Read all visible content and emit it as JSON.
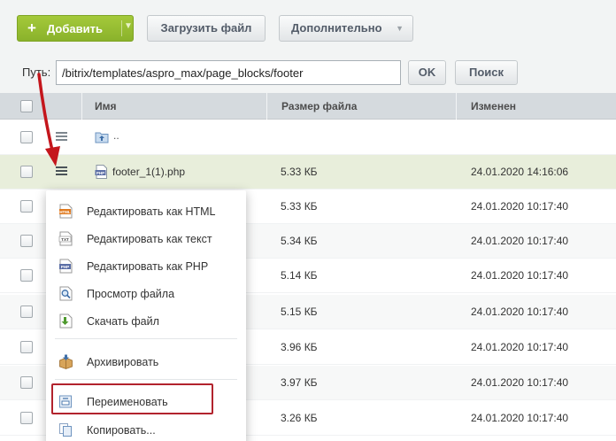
{
  "toolbar": {
    "add_label": "Добавить",
    "upload_label": "Загрузить файл",
    "more_label": "Дополнительно"
  },
  "path": {
    "label": "Путь:",
    "value": "/bitrix/templates/aspro_max/page_blocks/footer",
    "ok_label": "OK",
    "search_label": "Поиск"
  },
  "table": {
    "columns": [
      "Имя",
      "Размер файла",
      "Изменен"
    ],
    "up_label": "..",
    "rows": [
      {
        "name": "footer_1(1).php",
        "size": "5.33 КБ",
        "modified": "24.01.2020 14:16:06"
      },
      {
        "name": "",
        "size": "5.33 КБ",
        "modified": "24.01.2020 10:17:40"
      },
      {
        "name": "",
        "size": "5.34 КБ",
        "modified": "24.01.2020 10:17:40"
      },
      {
        "name": "",
        "size": "5.14 КБ",
        "modified": "24.01.2020 10:17:40"
      },
      {
        "name": "",
        "size": "5.15 КБ",
        "modified": "24.01.2020 10:17:40"
      },
      {
        "name": "",
        "size": "3.96 КБ",
        "modified": "24.01.2020 10:17:40"
      },
      {
        "name": "",
        "size": "3.97 КБ",
        "modified": "24.01.2020 10:17:40"
      },
      {
        "name": "",
        "size": "3.26 КБ",
        "modified": "24.01.2020 10:17:40"
      }
    ]
  },
  "menu": {
    "items": [
      {
        "label": "Редактировать как HTML",
        "icon": "html-icon"
      },
      {
        "label": "Редактировать как текст",
        "icon": "txt-icon"
      },
      {
        "label": "Редактировать как PHP",
        "icon": "php-icon"
      },
      {
        "label": "Просмотр файла",
        "icon": "view-icon"
      },
      {
        "label": "Скачать файл",
        "icon": "download-icon"
      },
      {
        "label": "Архивировать",
        "icon": "archive-icon"
      },
      {
        "label": "Переименовать",
        "icon": "rename-icon"
      },
      {
        "label": "Копировать...",
        "icon": "copy-icon"
      }
    ]
  },
  "colors": {
    "accent_green": "#8ab22b",
    "selected_row": "#e8eedb",
    "highlight_red": "#b2232d"
  }
}
